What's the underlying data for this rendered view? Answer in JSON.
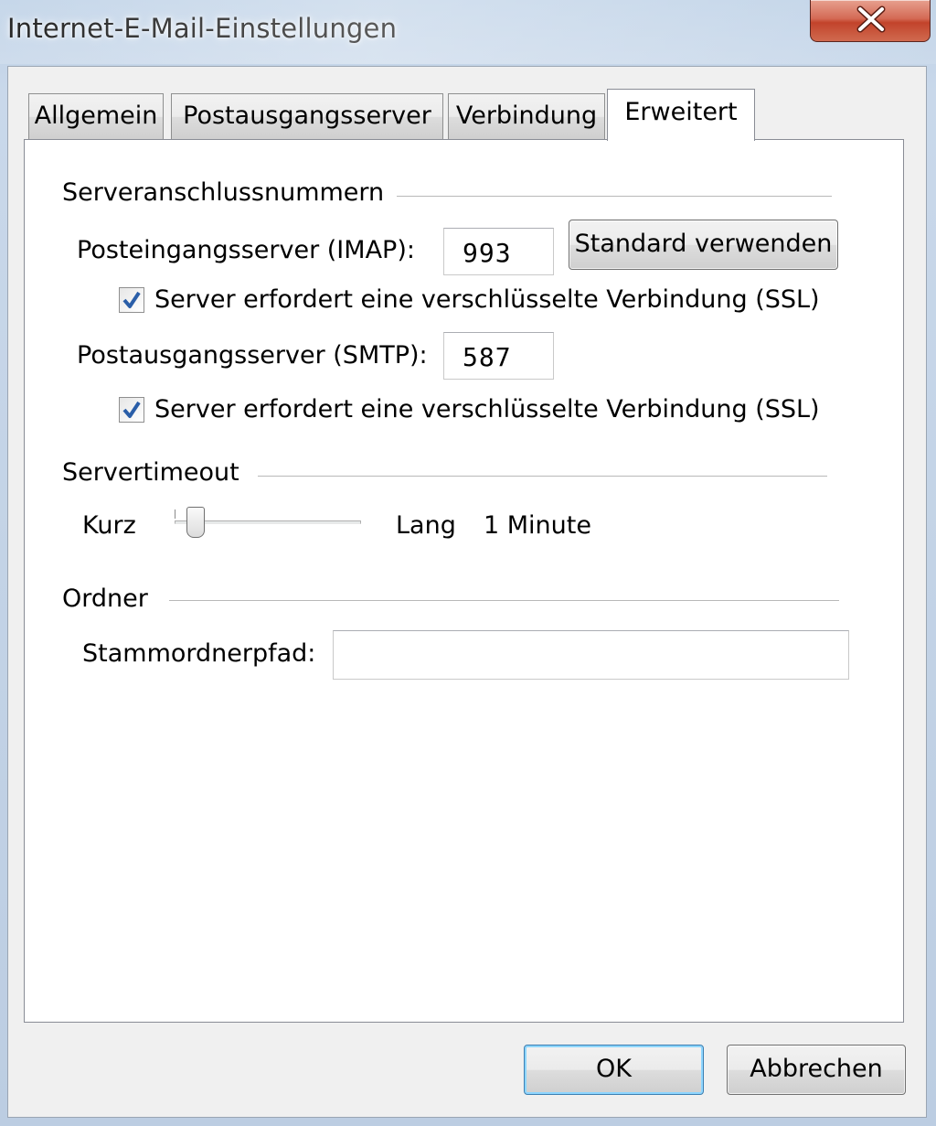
{
  "window": {
    "title": "Internet-E-Mail-Einstellungen",
    "close_symbol": "x"
  },
  "tabs": [
    {
      "label": "Allgemein",
      "active": false
    },
    {
      "label": "Postausgangsserver",
      "active": false
    },
    {
      "label": "Verbindung",
      "active": false
    },
    {
      "label": "Erweitert",
      "active": true
    }
  ],
  "ports": {
    "section_title": "Serveranschlussnummern",
    "imap_label": "Posteingangsserver (IMAP):",
    "imap_value": "993",
    "default_button": "Standard verwenden",
    "imap_ssl_label": "Server erfordert eine verschlüsselte Verbindung (SSL)",
    "imap_ssl_checked": true,
    "smtp_label": "Postausgangsserver (SMTP):",
    "smtp_value": "587",
    "smtp_ssl_label": "Server erfordert eine verschlüsselte Verbindung (SSL)",
    "smtp_ssl_checked": true
  },
  "timeout": {
    "section_title": "Servertimeout",
    "short_label": "Kurz",
    "long_label": "Lang",
    "value_text": "1 Minute",
    "slider_fraction": 0.05
  },
  "folders": {
    "section_title": "Ordner",
    "root_path_label": "Stammordnerpfad:",
    "root_path_value": ""
  },
  "footer": {
    "ok_label": "OK",
    "cancel_label": "Abbrechen"
  },
  "icons": {
    "close": "close-icon",
    "check": "checkmark-icon"
  },
  "colors": {
    "close_button": "#c7432b",
    "check_mark": "#2a5ea8",
    "default_button_glow": "#8ed6ff"
  }
}
